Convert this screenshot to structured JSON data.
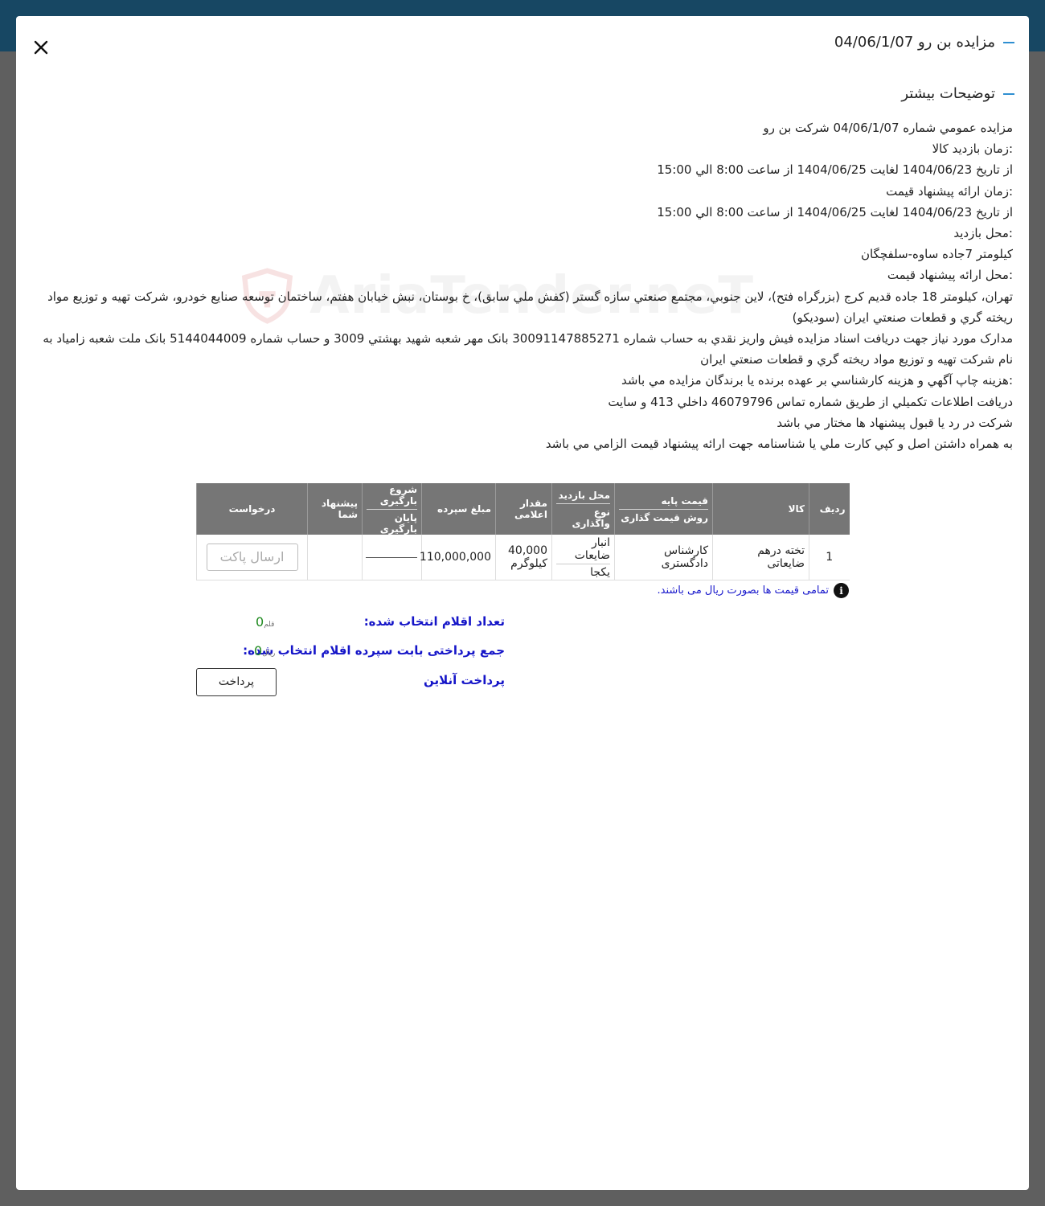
{
  "modal": {
    "title": "مزایده بن رو 04/06/1/07",
    "section_title": "توضیحات بیشتر",
    "watermark_text": "AriaTender.neT"
  },
  "description": [
    "مزايده عمومي شماره 04/06/1/07 شركت بن رو",
    ":زمان بازدید کالا",
    "از تاریخ 1404/06/23 لغایت 1404/06/25 از ساعت 8:00 الي 15:00",
    ":زمان ارائه پیشنهاد قیمت",
    "از تاریخ 1404/06/23 لغایت 1404/06/25 از ساعت 8:00 الي 15:00",
    ":محل بازدید",
    "كيلومتر 7جاده ساوه-سلفچگان",
    ":محل ارائه پیشنهاد قیمت",
    "تهران، كيلومتر 18 جاده قديم كرج (بزرگراه فتح)، لاين جنوبي، مجتمع صنعتي سازه گستر (كفش ملي سابق)، خ بوستان، نبش خيابان هفتم، ساختمان توسعه صنايع خودرو، شركت تهيه و توزيع مواد ريخته گري و قطعات صنعتي ايران (سوديكو)",
    "مدارک مورد نیاز جهت دریافت اسناد مزايده فيش واريز نقدي به حساب شماره 30091147885271 بانک مهر شعبه شهيد بهشتي 3009 و حساب شماره 5144044009 بانک ملت شعبه زامياد به نام شركت تهيه و توزيع مواد ريخته گري و قطعات صنعتي ايران",
    ":هزينه چاپ آگهي و هزينه كارشناسي بر عهده برنده يا برندگان مزايده مي باشد",
    "دريافت اطلاعات تكميلي از طريق شماره تماس 46079796 داخلي 413 و سايت",
    "شركت در رد يا قبول پيشنهاد ها مختار مي باشد",
    "به همراه داشتن اصل و كپي كارت ملي يا شناسنامه جهت ارائه پيشنهاد قيمت الزامي مي باشد"
  ],
  "table": {
    "headers": {
      "row": "ردیف",
      "item": "کالا",
      "base_price": "قیمت پایه",
      "pricing_method": "روش قیمت گذاری",
      "visit_location": "محل بازدید",
      "transfer_type": "نوع واگذاری",
      "quantity": "مقدار اعلامی",
      "deposit": "مبلغ سپرده",
      "loading_start": "شروع بارگیری",
      "loading_end": "پایان بارگیری",
      "your_offer": "پیشنهاد شما",
      "request": "درخواست"
    },
    "rows": [
      {
        "row": "1",
        "item": "تخته درهم ضایعاتی",
        "pricing_method": "کارشناس دادگستری",
        "visit_location": "انبار ضایعات",
        "transfer_type": "یکجا",
        "quantity": "40,000",
        "unit": "کیلوگرم",
        "deposit": "110,000,000",
        "send_label": "ارسال پاکت"
      }
    ]
  },
  "note": "تمامی قیمت ها بصورت ریال می باشند.",
  "summary": {
    "selected_label": "تعداد اقلام انتخاب شده:",
    "selected_count": "0",
    "selected_unit": "قلم",
    "total_label": "جمع پرداختی بابت سپرده اقلام انتخاب شده:",
    "total_value": "0",
    "total_unit": "ریال",
    "online_pay_label": "پرداخت آنلاین",
    "pay_button": "پرداخت"
  },
  "colors": {
    "topbar": "#174763",
    "overlay": "#5f5f5f",
    "header_bg": "#767676",
    "accent_dash": "#2f8fd1",
    "label_blue": "#1515c8",
    "value_green": "#1f8a1f"
  },
  "icons": [
    "close-icon",
    "info-icon",
    "shield-logo-icon"
  ]
}
